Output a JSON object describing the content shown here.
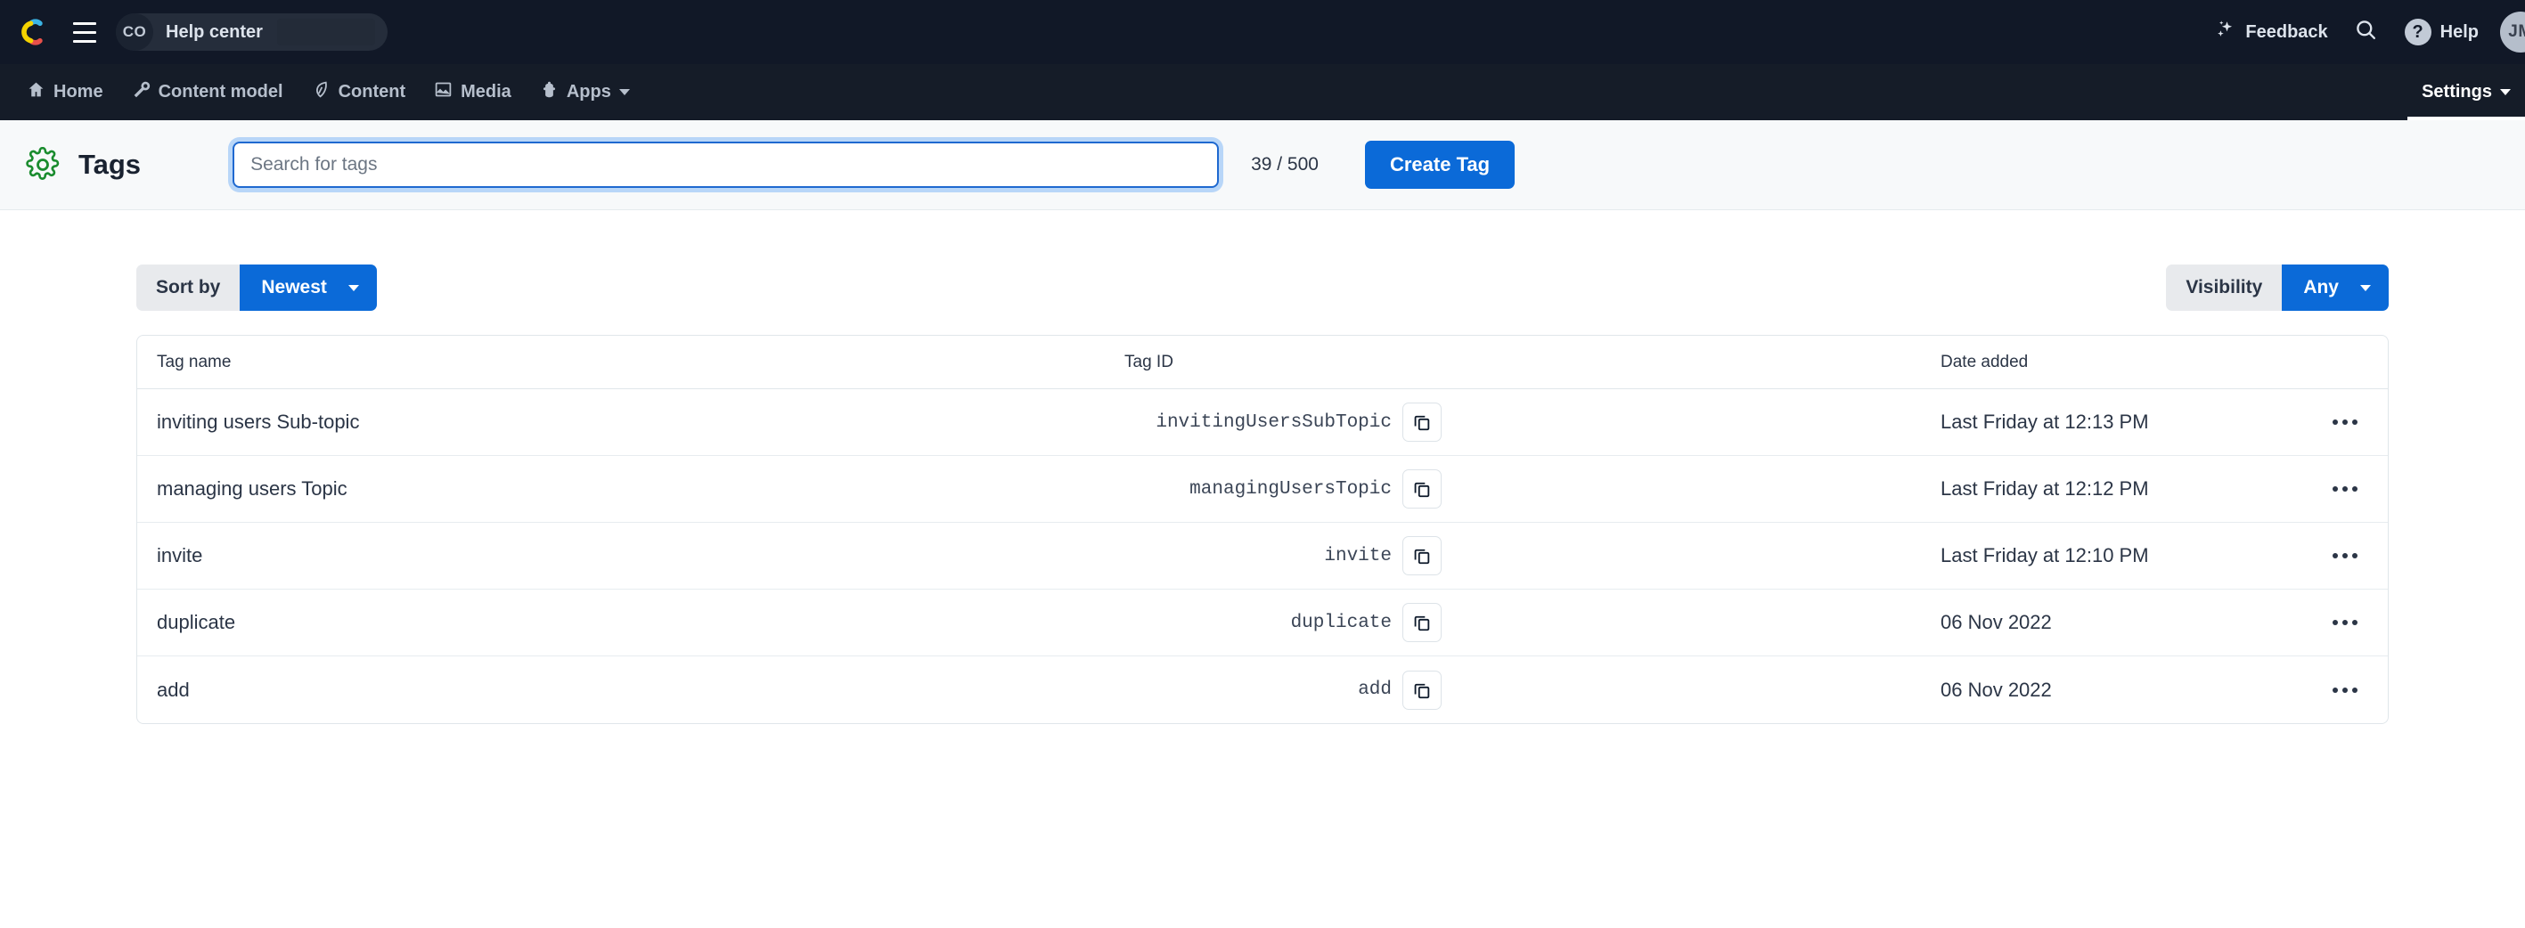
{
  "topbar": {
    "logo_icon": "contentful-logo-icon",
    "menu_icon": "hamburger-menu-icon",
    "breadcrumb": {
      "space_initials": "CO",
      "space_name": "Help center"
    },
    "feedback_label": "Feedback",
    "feedback_icon": "sparkle-icon",
    "search_icon": "search-icon",
    "help_label": "Help",
    "help_icon": "question-mark-icon",
    "user_initials": "JM"
  },
  "nav": {
    "items": [
      {
        "label": "Home",
        "icon": "home-icon",
        "active": false,
        "caret": false
      },
      {
        "label": "Content model",
        "icon": "wrench-icon",
        "active": false,
        "caret": false
      },
      {
        "label": "Content",
        "icon": "pen-nib-icon",
        "active": false,
        "caret": false
      },
      {
        "label": "Media",
        "icon": "image-icon",
        "active": false,
        "caret": false
      },
      {
        "label": "Apps",
        "icon": "apps-icon",
        "active": false,
        "caret": true
      }
    ],
    "settings": {
      "label": "Settings",
      "active": true,
      "caret": true
    }
  },
  "header": {
    "gear_icon": "gear-icon",
    "gear_color": "#1a8c2e",
    "title": "Tags",
    "search_placeholder": "Search for tags",
    "search_value": "",
    "count": "39 / 500",
    "create_label": "Create Tag"
  },
  "controls": {
    "sort": {
      "label": "Sort by",
      "value": "Newest"
    },
    "visibility": {
      "label": "Visibility",
      "value": "Any"
    }
  },
  "table": {
    "columns": [
      "Tag name",
      "Tag ID",
      "Date added"
    ],
    "copy_icon": "copy-icon",
    "menu_icon": "ellipsis-icon",
    "rows": [
      {
        "name": "inviting users Sub-topic",
        "id": "invitingUsersSubTopic",
        "date": "Last Friday at 12:13 PM"
      },
      {
        "name": "managing users Topic",
        "id": "managingUsersTopic",
        "date": "Last Friday at 12:12 PM"
      },
      {
        "name": "invite",
        "id": "invite",
        "date": "Last Friday at 12:10 PM"
      },
      {
        "name": "duplicate",
        "id": "duplicate",
        "date": "06 Nov 2022"
      },
      {
        "name": "add",
        "id": "add",
        "date": "06 Nov 2022"
      }
    ]
  },
  "colors": {
    "topbar_bg": "#111827",
    "navbar_bg": "#151c28",
    "accent_blue": "#0b6ad8",
    "gear_green": "#1a8c2e"
  }
}
